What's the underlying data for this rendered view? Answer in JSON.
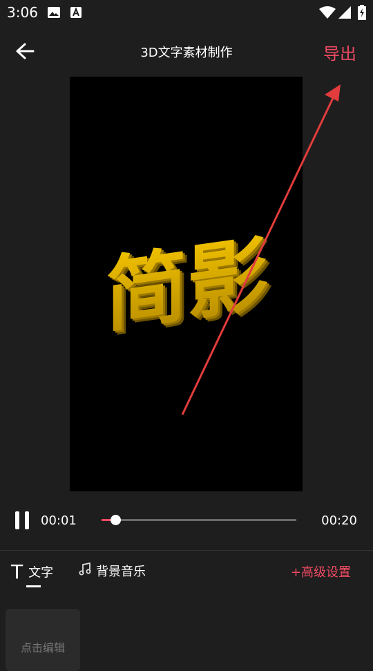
{
  "status_bar": {
    "time": "3:06"
  },
  "header": {
    "title": "3D文字素材制作",
    "export_label": "导出"
  },
  "preview": {
    "text": "简影"
  },
  "playback": {
    "current_time": "00:01",
    "total_time": "00:20",
    "progress": 0.07
  },
  "tabs": [
    {
      "label": "文字",
      "icon": "T"
    },
    {
      "label": "背景音乐"
    }
  ],
  "advanced_label": "+高级设置",
  "edit_card": {
    "label": "点击编辑"
  },
  "colors": {
    "accent": "#f04a62",
    "background": "#1e1e1e",
    "text_3d": "#d6a400"
  }
}
